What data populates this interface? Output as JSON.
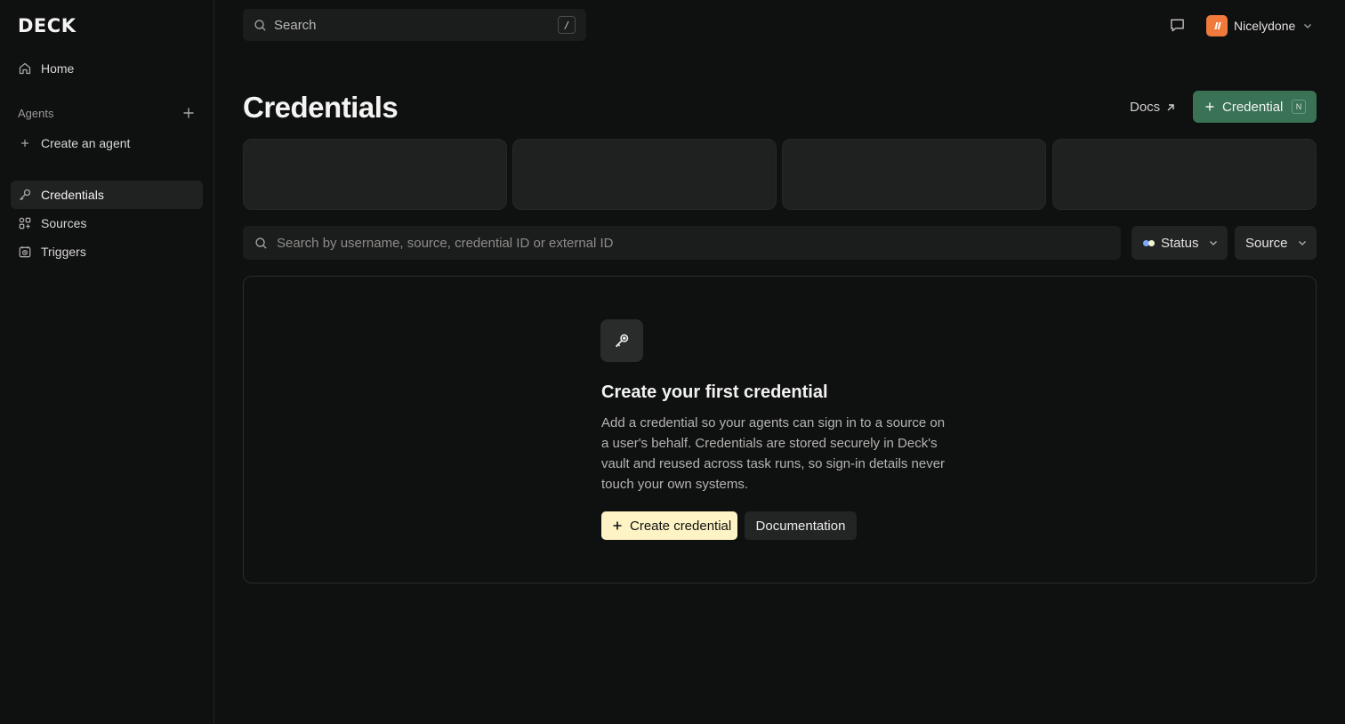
{
  "sidebar": {
    "logo": "DECK",
    "home_label": "Home",
    "agents_section_label": "Agents",
    "create_agent_label": "Create an agent",
    "items": [
      {
        "label": "Credentials",
        "icon": "key-icon",
        "active": true
      },
      {
        "label": "Sources",
        "icon": "grid-icon",
        "active": false
      },
      {
        "label": "Triggers",
        "icon": "calendar-clock-icon",
        "active": false
      }
    ]
  },
  "topbar": {
    "search_placeholder": "Search",
    "search_shortcut": "/",
    "account_name": "Nicelydone"
  },
  "header": {
    "title": "Credentials",
    "docs_label": "Docs",
    "primary_button_label": "Credential",
    "primary_button_shortcut": "N"
  },
  "filters": {
    "search_placeholder": "Search by username, source, credential ID or external ID",
    "status_label": "Status",
    "source_label": "Source"
  },
  "empty_state": {
    "title": "Create your first credential",
    "description": "Add a credential so your agents can sign in to a source on a user's behalf. Credentials are stored securely in Deck's vault and reused across task runs, so sign-in details never touch your own systems.",
    "primary_cta": "Create credential",
    "secondary_cta": "Documentation"
  },
  "colors": {
    "background": "#0f1010",
    "accent_green": "#3a7256",
    "cta_cream": "#fdf3c4",
    "avatar_orange": "#f07a3c"
  }
}
